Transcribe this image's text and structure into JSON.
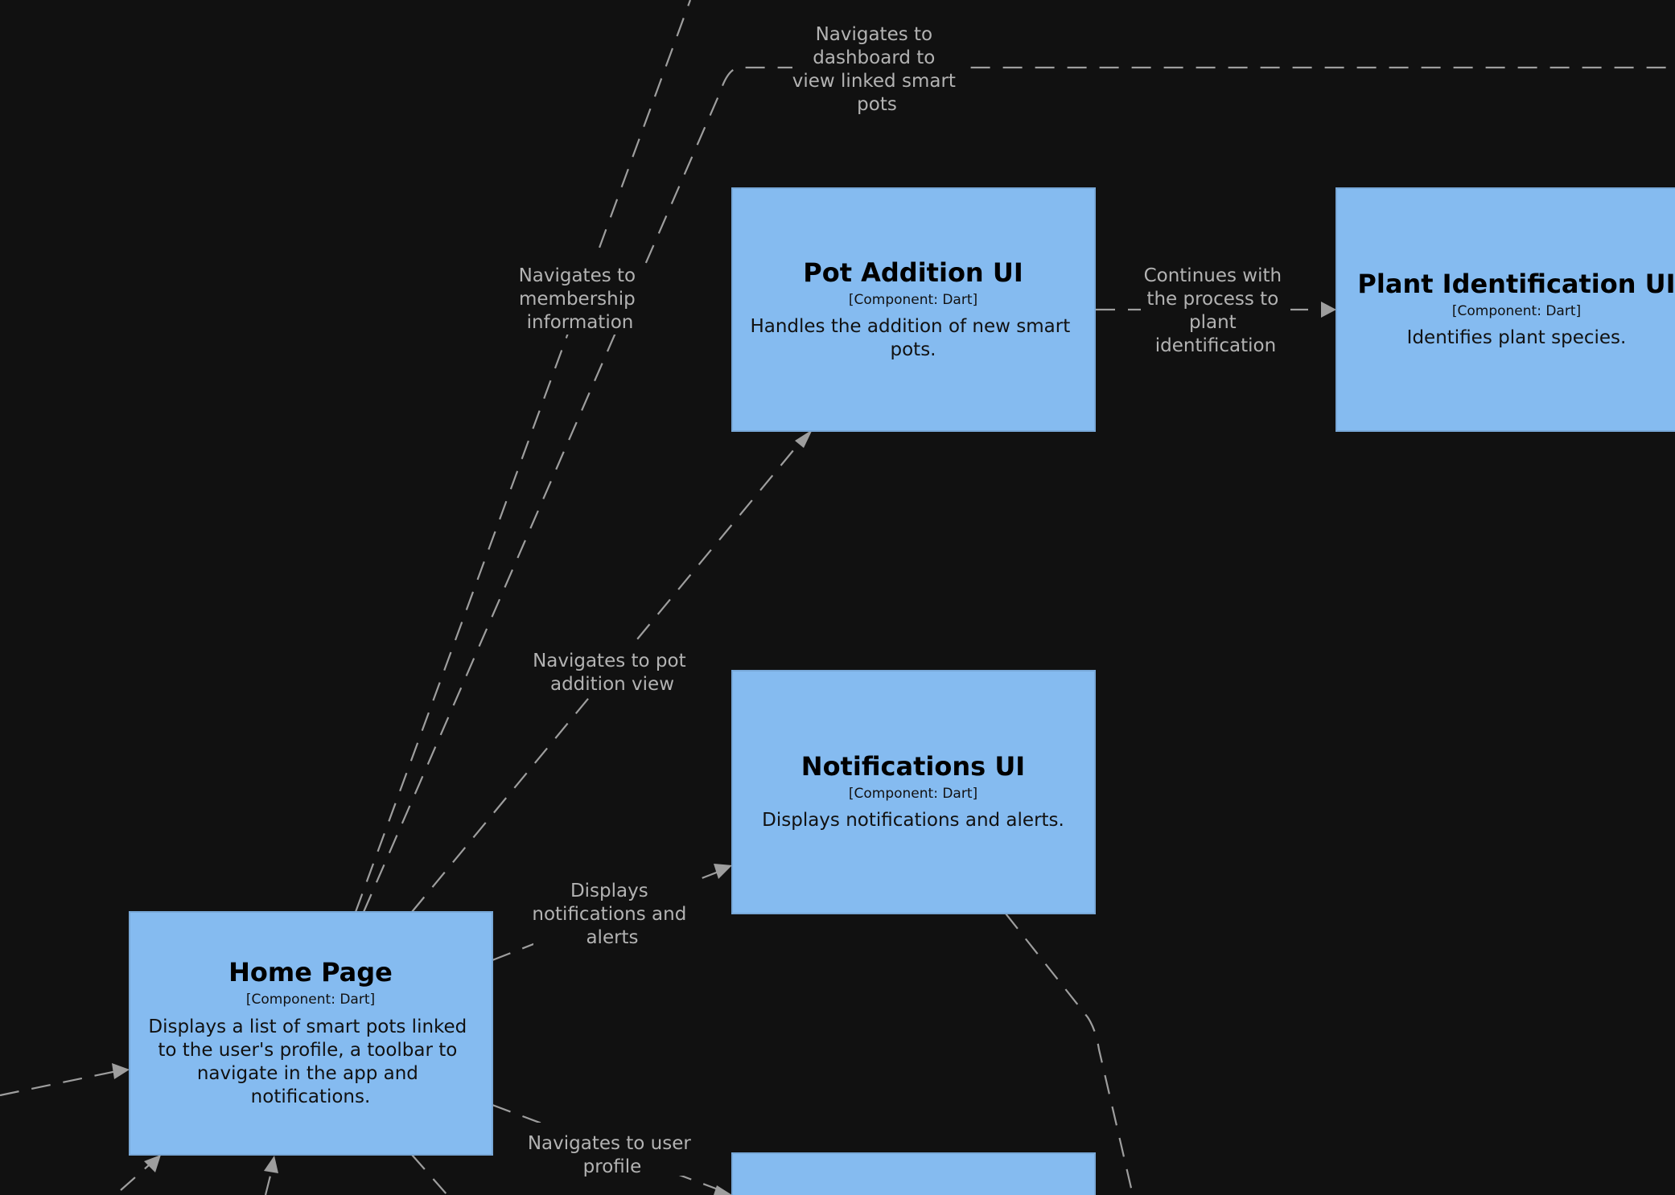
{
  "colors": {
    "background": "#111111",
    "component_fill": "#85BBF0",
    "component_stroke": "#78A8D8",
    "edge": "#9E9E9E",
    "edge_label": "#B3B3B3"
  },
  "components": {
    "pot_addition": {
      "title": "Pot Addition UI",
      "tech": "[Component: Dart]",
      "desc": [
        "Handles the addition of new smart",
        "pots."
      ]
    },
    "plant_identification": {
      "title": "Plant Identification UI",
      "tech": "[Component: Dart]",
      "desc": [
        "Identifies plant species."
      ]
    },
    "notifications": {
      "title": "Notifications UI",
      "tech": "[Component: Dart]",
      "desc": [
        "Displays notifications and alerts."
      ]
    },
    "home_page": {
      "title": "Home Page",
      "tech": "[Component: Dart]",
      "desc": [
        "Displays a list of smart pots linked",
        "to the user's profile, a toolbar to",
        "navigate in the app and",
        "notifications."
      ]
    },
    "user_profile": {
      "title": "",
      "tech": "",
      "desc": []
    }
  },
  "relationships": {
    "dashboard": [
      "Navigates to",
      "dashboard to",
      "view linked smart",
      "pots"
    ],
    "membership": [
      "Navigates to",
      "membership",
      "information"
    ],
    "continues": [
      "Continues with",
      "the process to",
      "plant",
      "identification"
    ],
    "pot_addition_view": [
      "Navigates to pot",
      "addition view"
    ],
    "notifications_alerts": [
      "Displays",
      "notifications and",
      "alerts"
    ],
    "user_profile": [
      "Navigates to user",
      "profile"
    ]
  }
}
